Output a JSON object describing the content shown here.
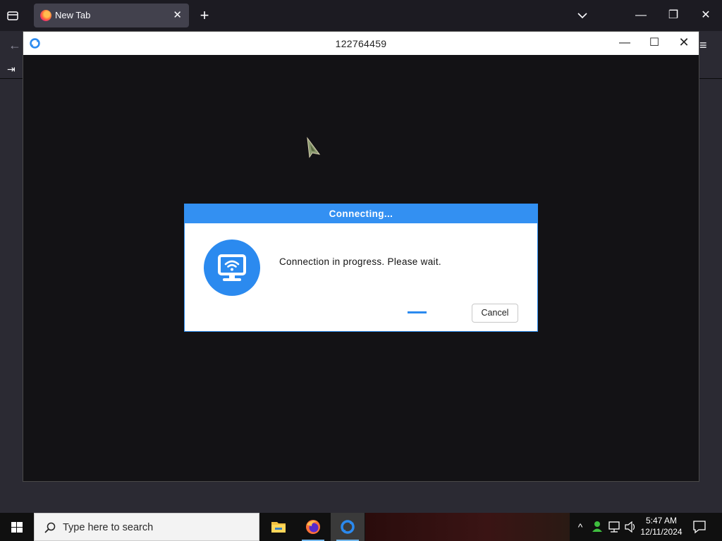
{
  "browser": {
    "tab_title": "New Tab",
    "tab_close": "✕",
    "new_tab": "+",
    "window_controls": {
      "minimize": "—",
      "restore": "❐",
      "close": "✕"
    },
    "back": "←",
    "menu": "≡",
    "signin": "⇥"
  },
  "remote_window": {
    "title": "122764459",
    "controls": {
      "minimize": "—",
      "maximize": "☐",
      "close": "✕"
    }
  },
  "dialog": {
    "title": "Connecting...",
    "message": "Connection in progress. Please wait.",
    "cancel_label": "Cancel",
    "accent": "#3390f2"
  },
  "taskbar": {
    "search_placeholder": "Type here to search",
    "apps": [
      "file-explorer-icon",
      "firefox-icon",
      "remote-desktop-icon"
    ],
    "tray": {
      "chevron": "^",
      "time": "5:47 AM",
      "date": "12/11/2024"
    }
  }
}
